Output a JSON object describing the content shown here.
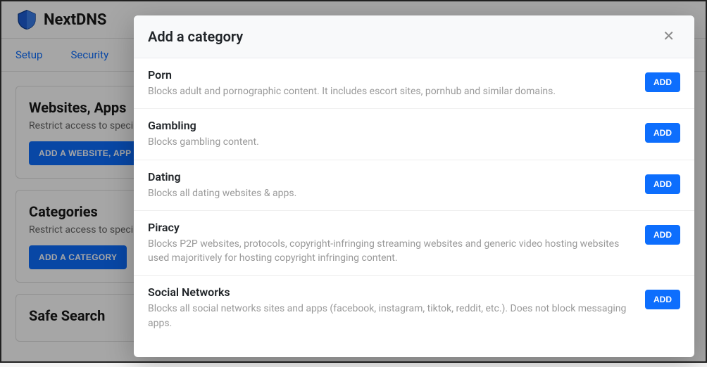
{
  "brand": "NextDNS",
  "tabs": {
    "setup": "Setup",
    "security": "Security"
  },
  "sections": {
    "websites": {
      "title": "Websites, Apps",
      "desc": "Restrict access to speci",
      "button": "ADD A WEBSITE, APP O"
    },
    "categories": {
      "title": "Categories",
      "desc": "Restrict access to speci",
      "button": "ADD A CATEGORY"
    },
    "safesearch": {
      "title": "Safe Search"
    }
  },
  "modal": {
    "title": "Add a category",
    "add_label": "ADD",
    "items": [
      {
        "name": "Porn",
        "desc": "Blocks adult and pornographic content. It includes escort sites, pornhub and similar domains."
      },
      {
        "name": "Gambling",
        "desc": "Blocks gambling content."
      },
      {
        "name": "Dating",
        "desc": "Blocks all dating websites & apps."
      },
      {
        "name": "Piracy",
        "desc": "Blocks P2P websites, protocols, copyright-infringing streaming websites and generic video hosting websites used majoritively for hosting copyright infringing content."
      },
      {
        "name": "Social Networks",
        "desc": "Blocks all social networks sites and apps (facebook, instagram, tiktok, reddit, etc.). Does not block messaging apps."
      }
    ]
  }
}
